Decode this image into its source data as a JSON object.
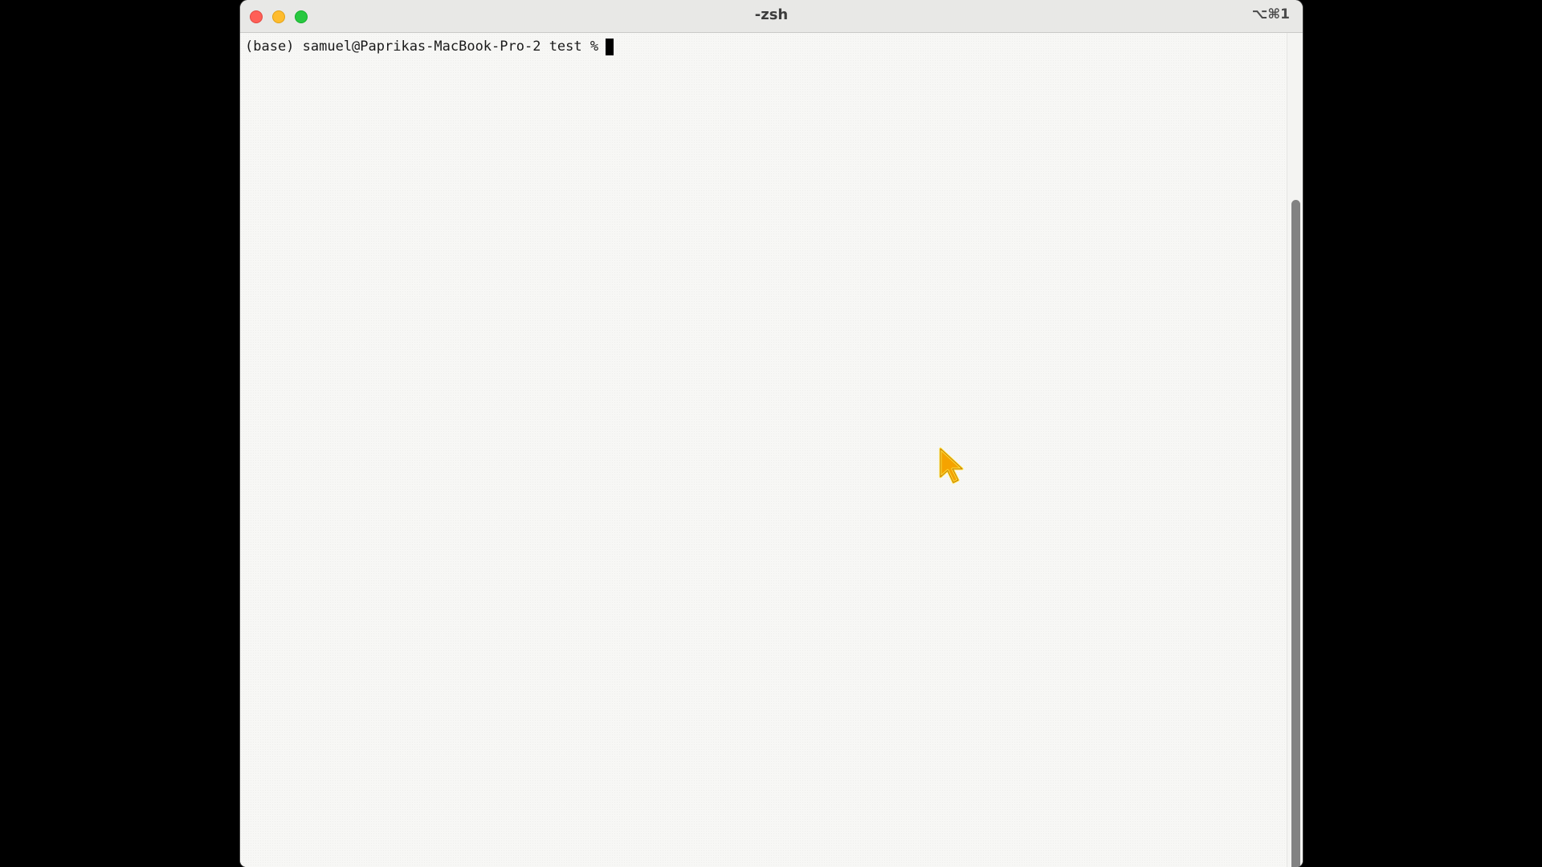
{
  "window": {
    "title": "-zsh",
    "shortcut": "⌥⌘1"
  },
  "terminal": {
    "prompt": "(base) samuel@Paprikas-MacBook-Pro-2 test %"
  },
  "icons": {
    "close": "close-traffic-light",
    "minimize": "minimize-traffic-light",
    "zoom": "zoom-traffic-light",
    "pointer": "mouse-pointer-icon"
  },
  "colors": {
    "close": "#ff5f57",
    "minimize": "#febc2e",
    "zoom": "#28c840",
    "pointer_fill": "#f5a300",
    "pointer_outline": "#ffe23a"
  }
}
